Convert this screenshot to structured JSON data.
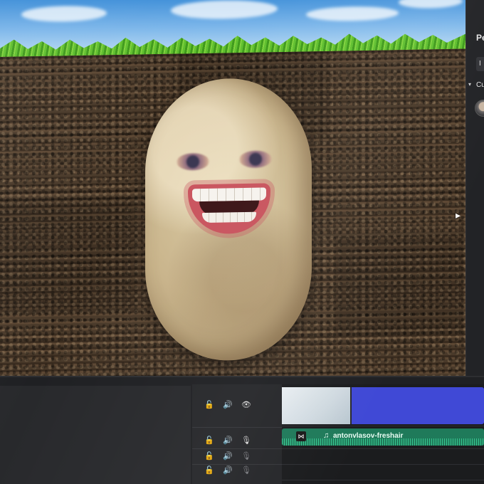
{
  "inspector": {
    "title": "Pe",
    "field_value": "I",
    "dropdown_label": "Cu",
    "avatar": "user-avatar"
  },
  "preview": {
    "background": "grass-and-soil-backdrop",
    "subject": "potato-face-character"
  },
  "timeline": {
    "video_track": {
      "locked": false,
      "icons": [
        "lock-icon",
        "speaker-icon",
        "eye-icon"
      ]
    },
    "audio_tracks": [
      {
        "icons": [
          "lock-icon",
          "speaker-icon",
          "mic-icon"
        ],
        "dimmed": false
      },
      {
        "icons": [
          "lock-icon",
          "speaker-icon",
          "mic-icon"
        ],
        "dimmed": true
      },
      {
        "icons": [
          "lock-icon",
          "speaker-icon",
          "mic-icon"
        ],
        "dimmed": true
      }
    ],
    "audio_clip": {
      "name": "antonvlasov-freshair",
      "color": "#1f7a5a"
    },
    "video_clip": {
      "color": "#4049d6"
    }
  },
  "glyphs": {
    "lock": "🔓",
    "speaker": "🔊",
    "eye": "👁",
    "mic": "🎙",
    "note": "♫",
    "caret": "▾",
    "transition": "⋈"
  }
}
